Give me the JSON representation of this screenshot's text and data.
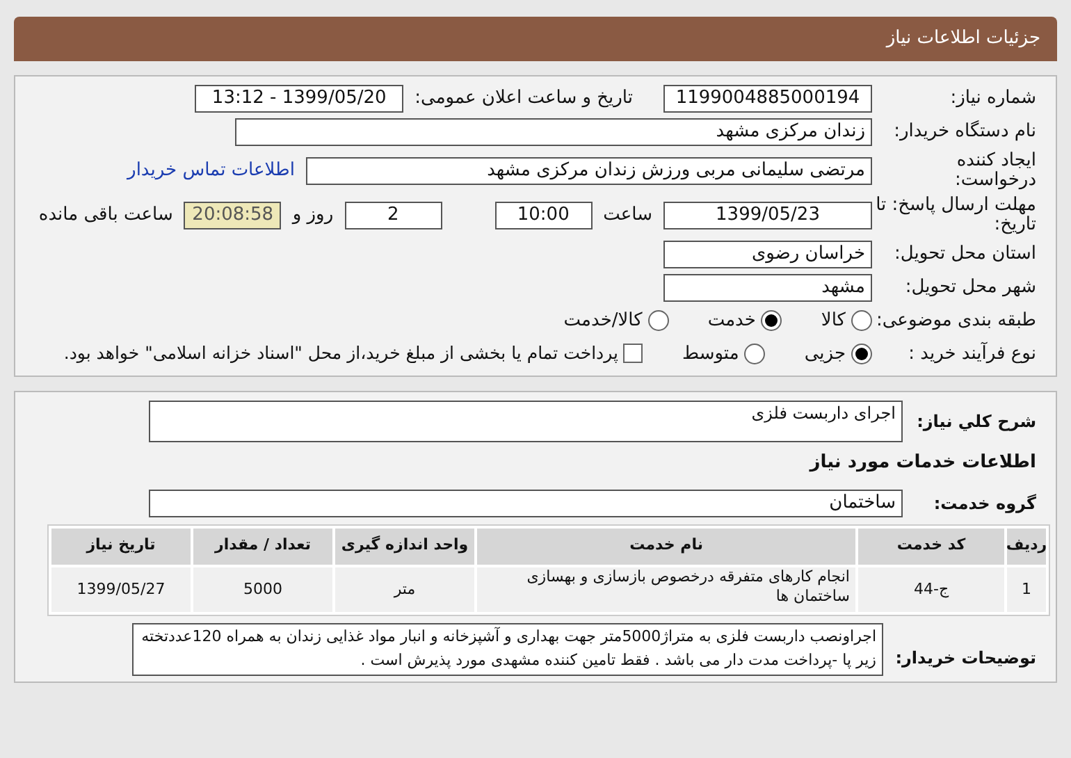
{
  "header": {
    "title": "جزئیات اطلاعات نیاز"
  },
  "details": {
    "need_number": {
      "label": "شماره نیاز:",
      "value": "1199004885000194"
    },
    "announce": {
      "label": "تاریخ و ساعت اعلان عمومی:",
      "value": "1399/05/20 - 13:12"
    },
    "buyer": {
      "label": "نام دستگاه خریدار:",
      "value": "زندان مرکزی مشهد"
    },
    "requester": {
      "label": "ایجاد کننده درخواست:",
      "value": "مرتضی سلیمانی مربی ورزش زندان مرکزی مشهد",
      "link": "اطلاعات تماس خریدار"
    },
    "deadline": {
      "label": "مهلت ارسال پاسخ: تا تاریخ:",
      "date": "1399/05/23",
      "time_label": "ساعت",
      "time": "10:00",
      "days": "2",
      "days_label": "روز و",
      "remaining": "20:08:58",
      "remaining_label": "ساعت باقی مانده"
    },
    "province": {
      "label": "استان محل تحویل:",
      "value": "خراسان رضوی"
    },
    "city": {
      "label": "شهر محل تحویل:",
      "value": "مشهد"
    },
    "category": {
      "label": "طبقه بندی موضوعی:",
      "options": [
        {
          "label": "کالا",
          "selected": false
        },
        {
          "label": "خدمت",
          "selected": true
        },
        {
          "label": "کالا/خدمت",
          "selected": false
        }
      ]
    },
    "process": {
      "label": "نوع فرآیند خرید :",
      "options": [
        {
          "label": "جزیی",
          "selected": true
        },
        {
          "label": "متوسط",
          "selected": false
        }
      ],
      "checkbox": {
        "checked": false,
        "label": "پرداخت تمام یا بخشی از مبلغ خرید،از محل \"اسناد خزانه اسلامی\" خواهد بود."
      }
    }
  },
  "services": {
    "summary": {
      "label": "شرح کلي نياز:",
      "value": "اجرای داربست فلزی"
    },
    "title": "اطلاعات خدمات مورد نیاز",
    "group": {
      "label": "گروه خدمت:",
      "value": "ساختمان"
    },
    "table": {
      "columns": [
        "ردیف",
        "کد خدمت",
        "نام خدمت",
        "واحد اندازه گیری",
        "تعداد / مقدار",
        "تاریخ نیاز"
      ],
      "rows": [
        [
          "1",
          "ج-44",
          "انجام کارهای متفرقه درخصوص بازسازی و بهسازی ساختمان ها",
          "متر",
          "5000",
          "1399/05/27"
        ]
      ]
    },
    "notes": {
      "label": "توضیحات خریدار:",
      "value": "اجراونصب داربست فلزی به متراژ5000متر جهت بهداری و آشپزخانه و انبار مواد غذایی زندان به همراه 120عددتخته زیر پا -پرداخت مدت دار می باشد . فقط تامین کننده مشهدی مورد پذیرش است ."
    }
  }
}
